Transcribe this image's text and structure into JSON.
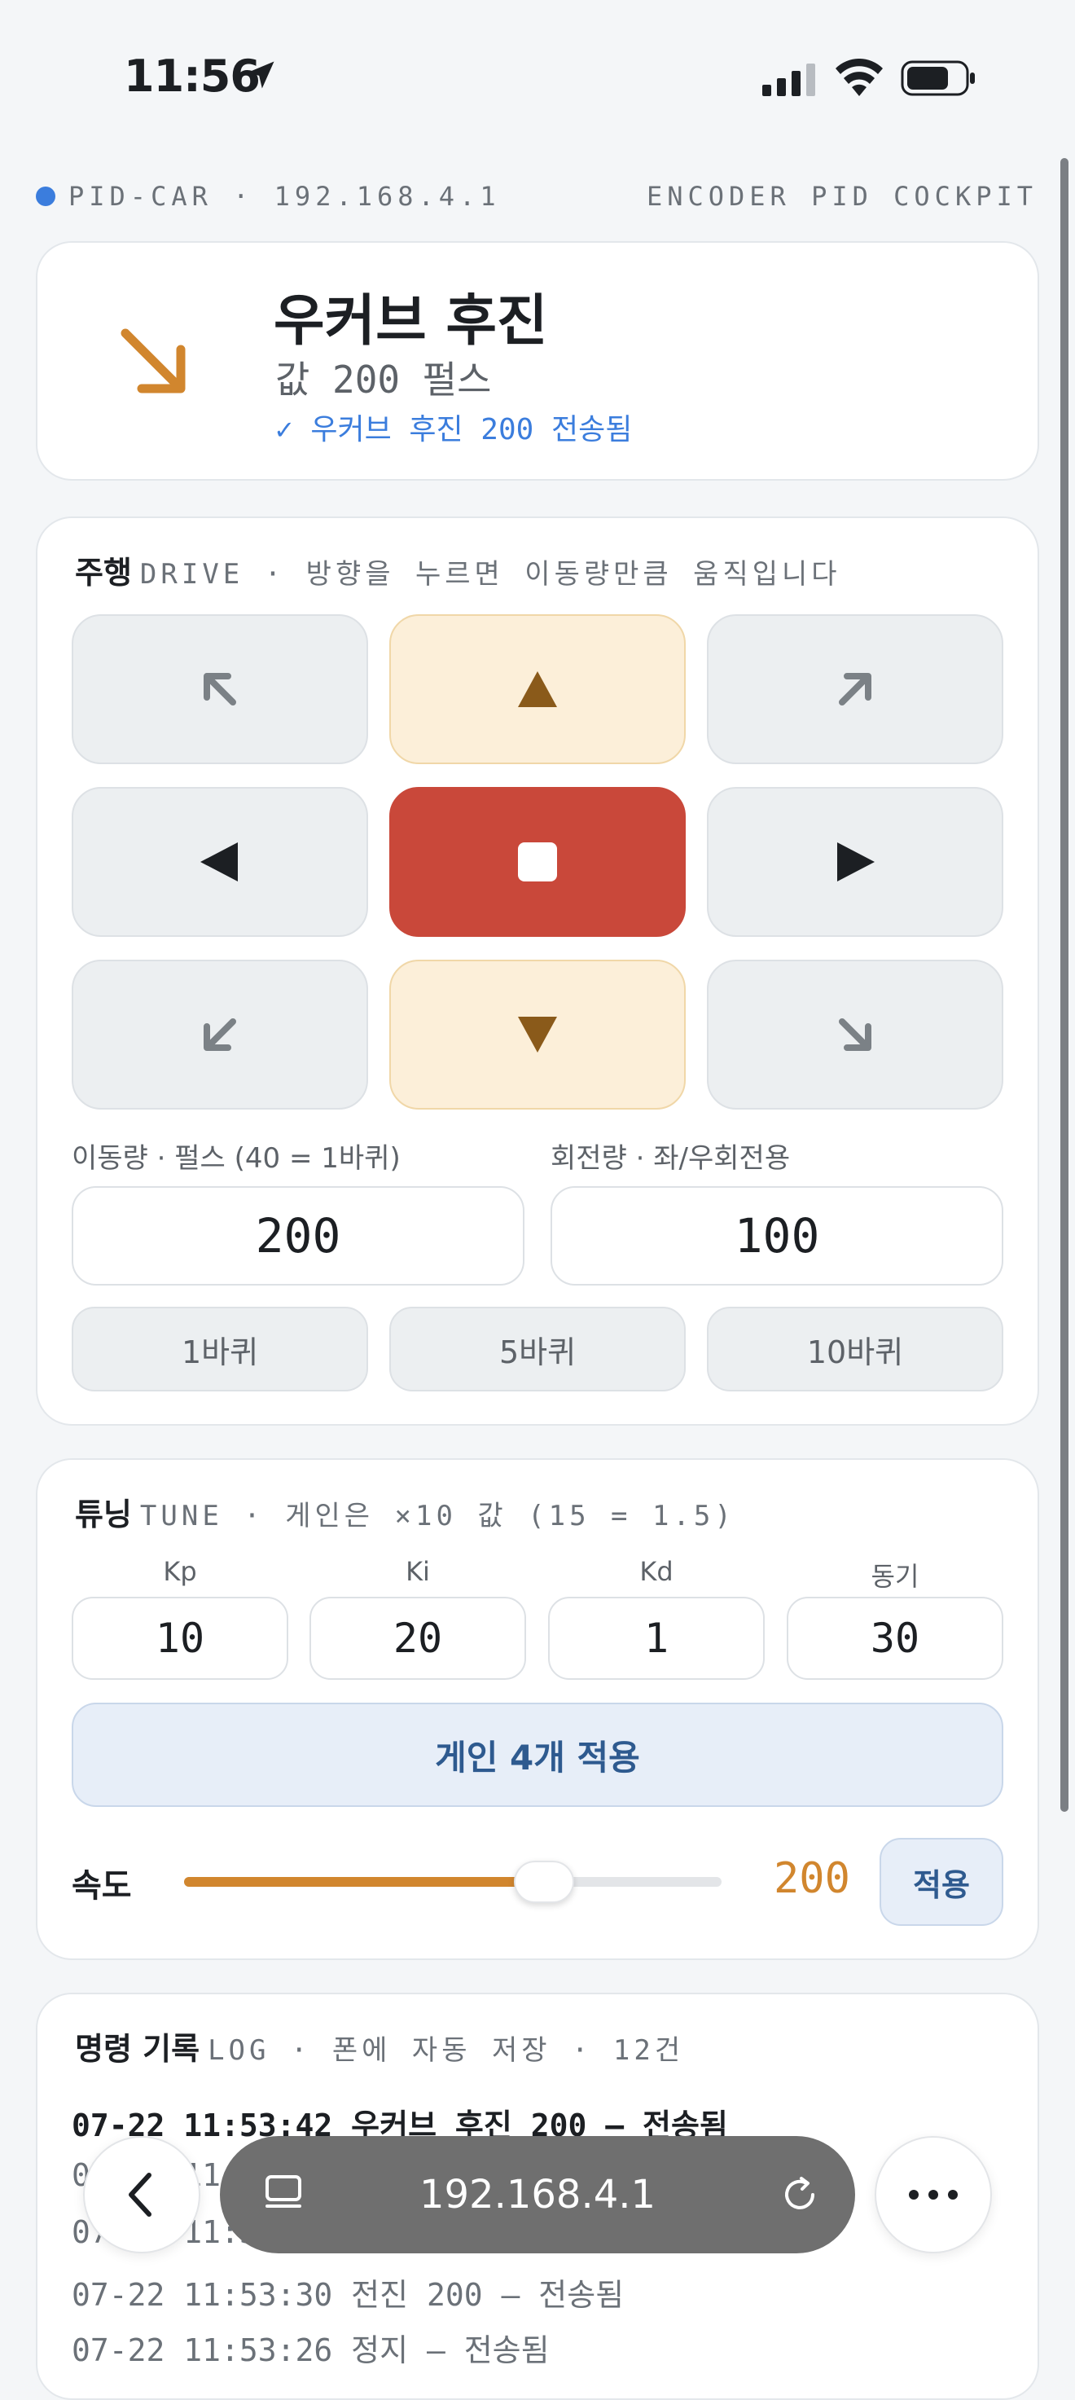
{
  "status_bar": {
    "time": "11:56"
  },
  "header": {
    "device": "PID-CAR · 192.168.4.1",
    "mode": "ENCODER PID COCKPIT"
  },
  "status_card": {
    "title": "우커브 후진",
    "value": "값 200 펄스",
    "sent": "✓ 우커브 후진 200 전송됨",
    "arrow_color": "#d1862e"
  },
  "drive": {
    "title": "주행",
    "subtitle": "DRIVE · 방향을 누르면 이동량만큼 움직입니다",
    "distance_label": "이동량 · 펄스 (40 = 1바퀴)",
    "distance_value": "200",
    "turn_label": "회전량 · 좌/우회전용",
    "turn_value": "100",
    "presets": [
      "1바퀴",
      "5바퀴",
      "10바퀴"
    ]
  },
  "tune": {
    "title": "튜닝",
    "subtitle": "TUNE · 게인은 ×10 값 (15 = 1.5)",
    "params": [
      {
        "label": "Kp",
        "value": "10"
      },
      {
        "label": "Ki",
        "value": "20"
      },
      {
        "label": "Kd",
        "value": "1"
      },
      {
        "label": "동기",
        "value": "30"
      }
    ],
    "apply_label": "게인 4개 적용",
    "speed_label": "속도",
    "speed_value": "200",
    "speed_fraction": 0.67,
    "speed_apply": "적용"
  },
  "log": {
    "title": "명령 기록",
    "subtitle": "LOG · 폰에 자동 저장 · 12건",
    "entries": [
      "07-22 11:53:42 우커브 후진 200 — 전송됨",
      "07-22 11:53:38",
      "07-22 11:53:34",
      "07-22 11:53:30 전진 200 — 전송됨",
      "07-22 11:53:26 정지 — 전송됨"
    ]
  },
  "browser": {
    "url": "192.168.4.1"
  },
  "colors": {
    "accent": "#d1862e",
    "stop": "#c9483a",
    "link": "#3b7ddd"
  }
}
